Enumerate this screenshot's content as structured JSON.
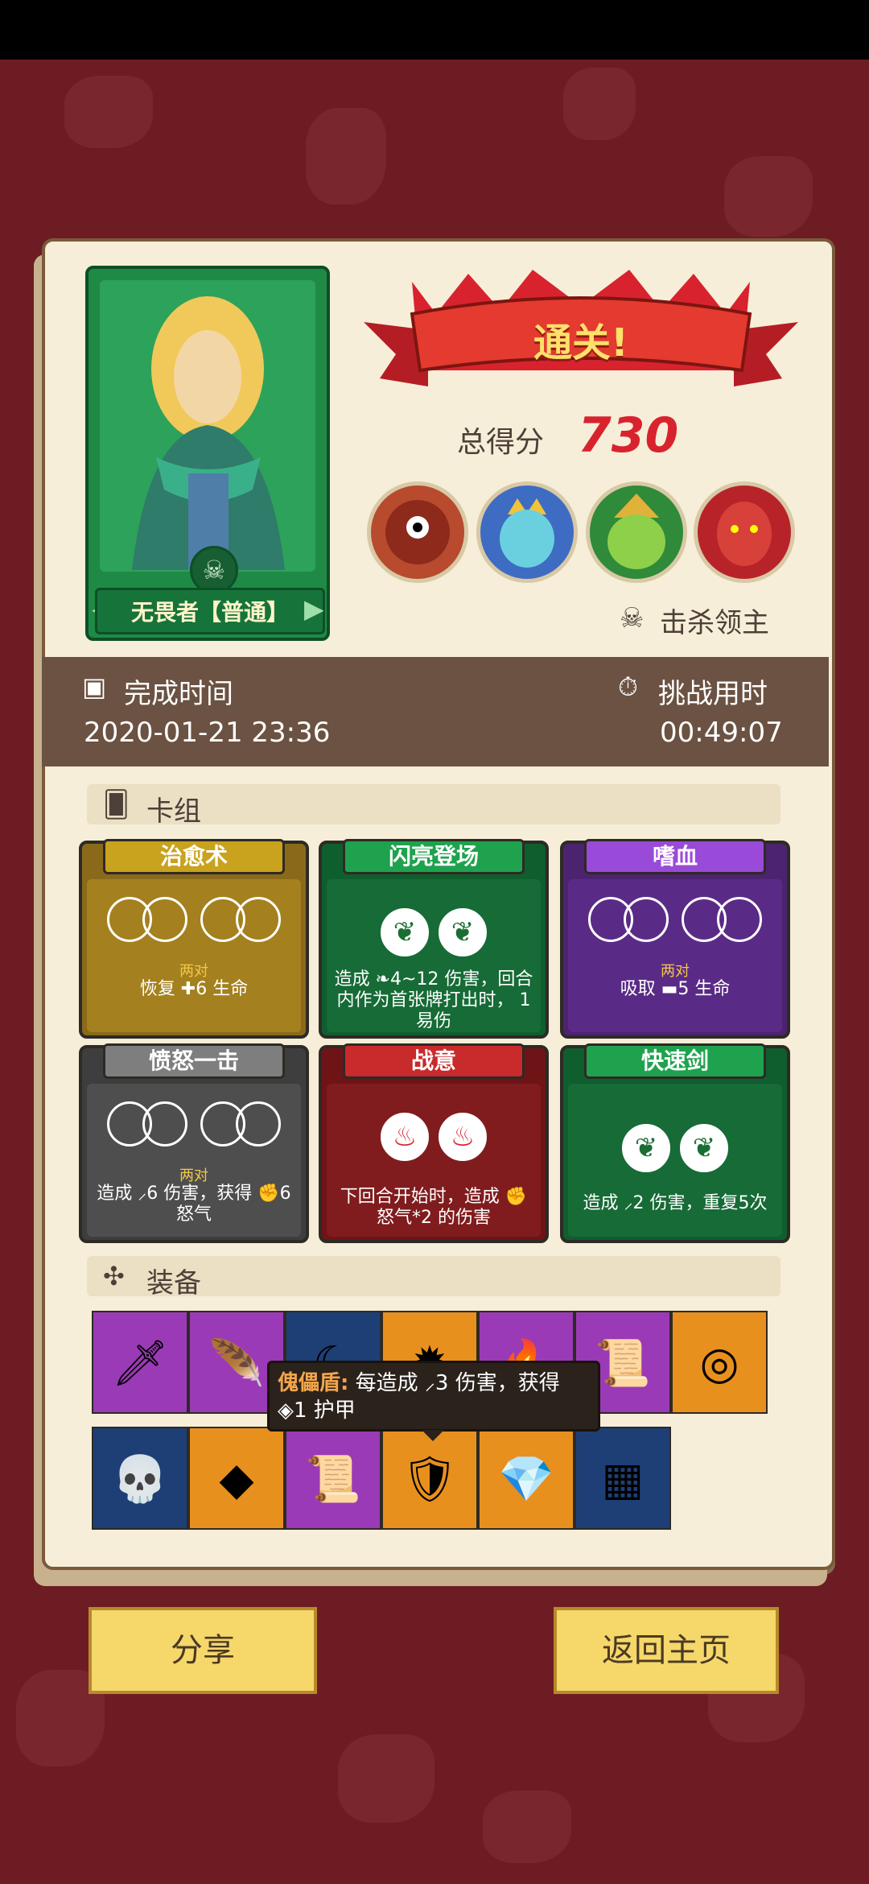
{
  "hero": {
    "name": "无畏者【普通】"
  },
  "result": {
    "title": "通关!",
    "score_label": "总得分",
    "score_value": "730",
    "kill_label": "击杀领主"
  },
  "times": {
    "finish_label": "完成时间",
    "finish_value": "2020-01-21 23:36",
    "duration_label": "挑战用时",
    "duration_value": "00:49:07"
  },
  "deck": {
    "section_label": "卡组",
    "cards": [
      {
        "name": "治愈术",
        "pair": "两对",
        "desc": "恢复 ✚6 生命"
      },
      {
        "name": "闪亮登场",
        "desc": "造成 ❧4~12 伤害，回合内作为首张牌打出时， 1 易伤"
      },
      {
        "name": "嗜血",
        "pair": "两对",
        "desc": "吸取 ▬5 生命"
      },
      {
        "name": "愤怒一击",
        "pair": "两对",
        "desc": "造成 ⸝6 伤害，获得 ✊6 怒气"
      },
      {
        "name": "战意",
        "desc": "下回合开始时，造成 ✊怒气*2 的伤害"
      },
      {
        "name": "快速剑",
        "desc": "造成 ⸝2 伤害，重复5次"
      }
    ]
  },
  "equipment": {
    "section_label": "装备",
    "tooltip_name": "傀儡盾:",
    "tooltip_text": "每造成 ⸝3 伤害，获得 ◈1 护甲"
  },
  "buttons": {
    "share": "分享",
    "home": "返回主页"
  }
}
